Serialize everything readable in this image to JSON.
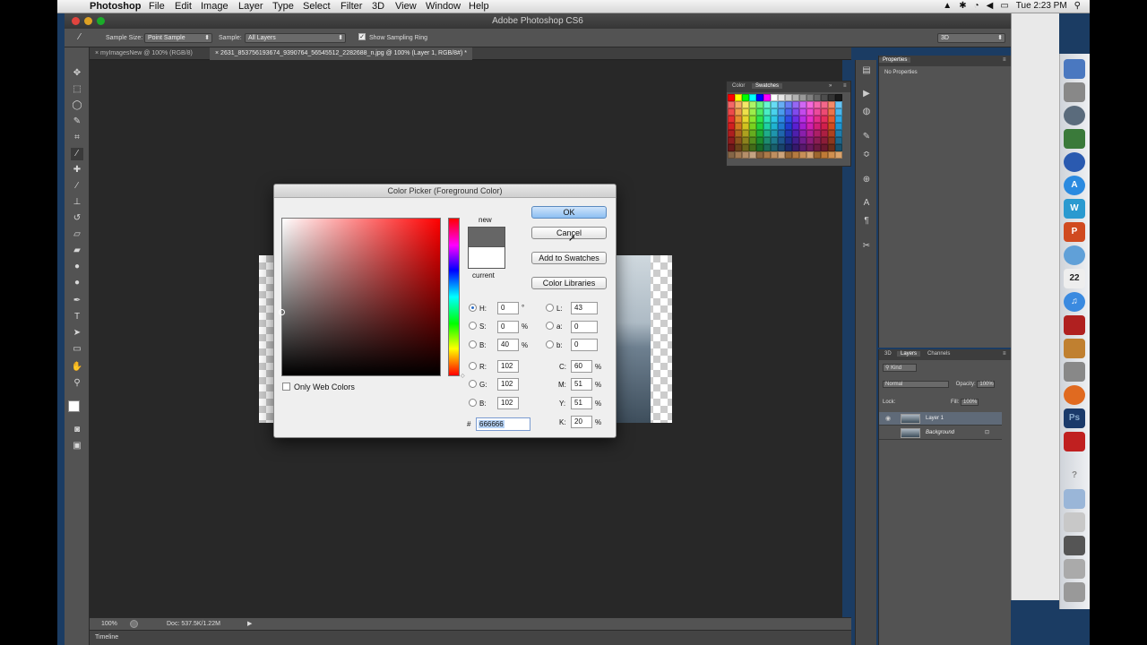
{
  "menubar": {
    "app": "Photoshop",
    "items": [
      "File",
      "Edit",
      "Image",
      "Layer",
      "Type",
      "Select",
      "Filter",
      "3D",
      "View",
      "Window",
      "Help"
    ],
    "clock": "Tue 2:23 PM"
  },
  "window": {
    "title": "Adobe Photoshop CS6"
  },
  "options": {
    "sample_size_label": "Sample Size:",
    "sample_size_value": "Point Sample",
    "sample_label": "Sample:",
    "sample_value": "All Layers",
    "show_ring_label": "Show Sampling Ring",
    "workspace": "3D"
  },
  "tabs": [
    {
      "label": "myImagesNew @ 100% (RGB/8)"
    },
    {
      "label": "2631_853756193674_9390764_56545512_2282688_n.jpg @ 100% (Layer 1, RGB/8#) *"
    }
  ],
  "status": {
    "zoom": "100%",
    "doc": "Doc: 537.5K/1.22M",
    "timeline": "Timeline"
  },
  "swatches_panel": {
    "tab_color": "Color",
    "tab_swatches": "Swatches"
  },
  "properties": {
    "title": "Properties",
    "body": "No Properties"
  },
  "layers_panel": {
    "tab_3d": "3D",
    "tab_layers": "Layers",
    "tab_channels": "Channels",
    "kind": "Kind",
    "blend_mode": "Normal",
    "opacity_label": "Opacity:",
    "opacity": "100%",
    "lock_label": "Lock:",
    "fill_label": "Fill:",
    "fill": "100%",
    "layers": [
      "Layer 1",
      "Background"
    ]
  },
  "dialog": {
    "title": "Color Picker (Foreground Color)",
    "new_label": "new",
    "current_label": "current",
    "ok": "OK",
    "cancel": "Cancel",
    "add_to_swatches": "Add to Swatches",
    "color_libraries": "Color Libraries",
    "only_web_colors": "Only Web Colors",
    "new_color": "#666666",
    "current_color": "#ffffff",
    "H": "0",
    "S": "0",
    "B": "40",
    "R": "102",
    "G": "102",
    "Bl": "102",
    "L": "43",
    "a": "0",
    "b": "0",
    "C": "60",
    "M": "51",
    "Y": "51",
    "K": "20",
    "hex": "666666",
    "deg": "°",
    "pct": "%",
    "labels": {
      "H": "H:",
      "S": "S:",
      "B": "B:",
      "R": "R:",
      "G": "G:",
      "Bl": "B:",
      "L": "L:",
      "a": "a:",
      "b": "b:",
      "C": "C:",
      "M": "M:",
      "Y": "Y:",
      "K": "K:",
      "hash": "#"
    }
  }
}
